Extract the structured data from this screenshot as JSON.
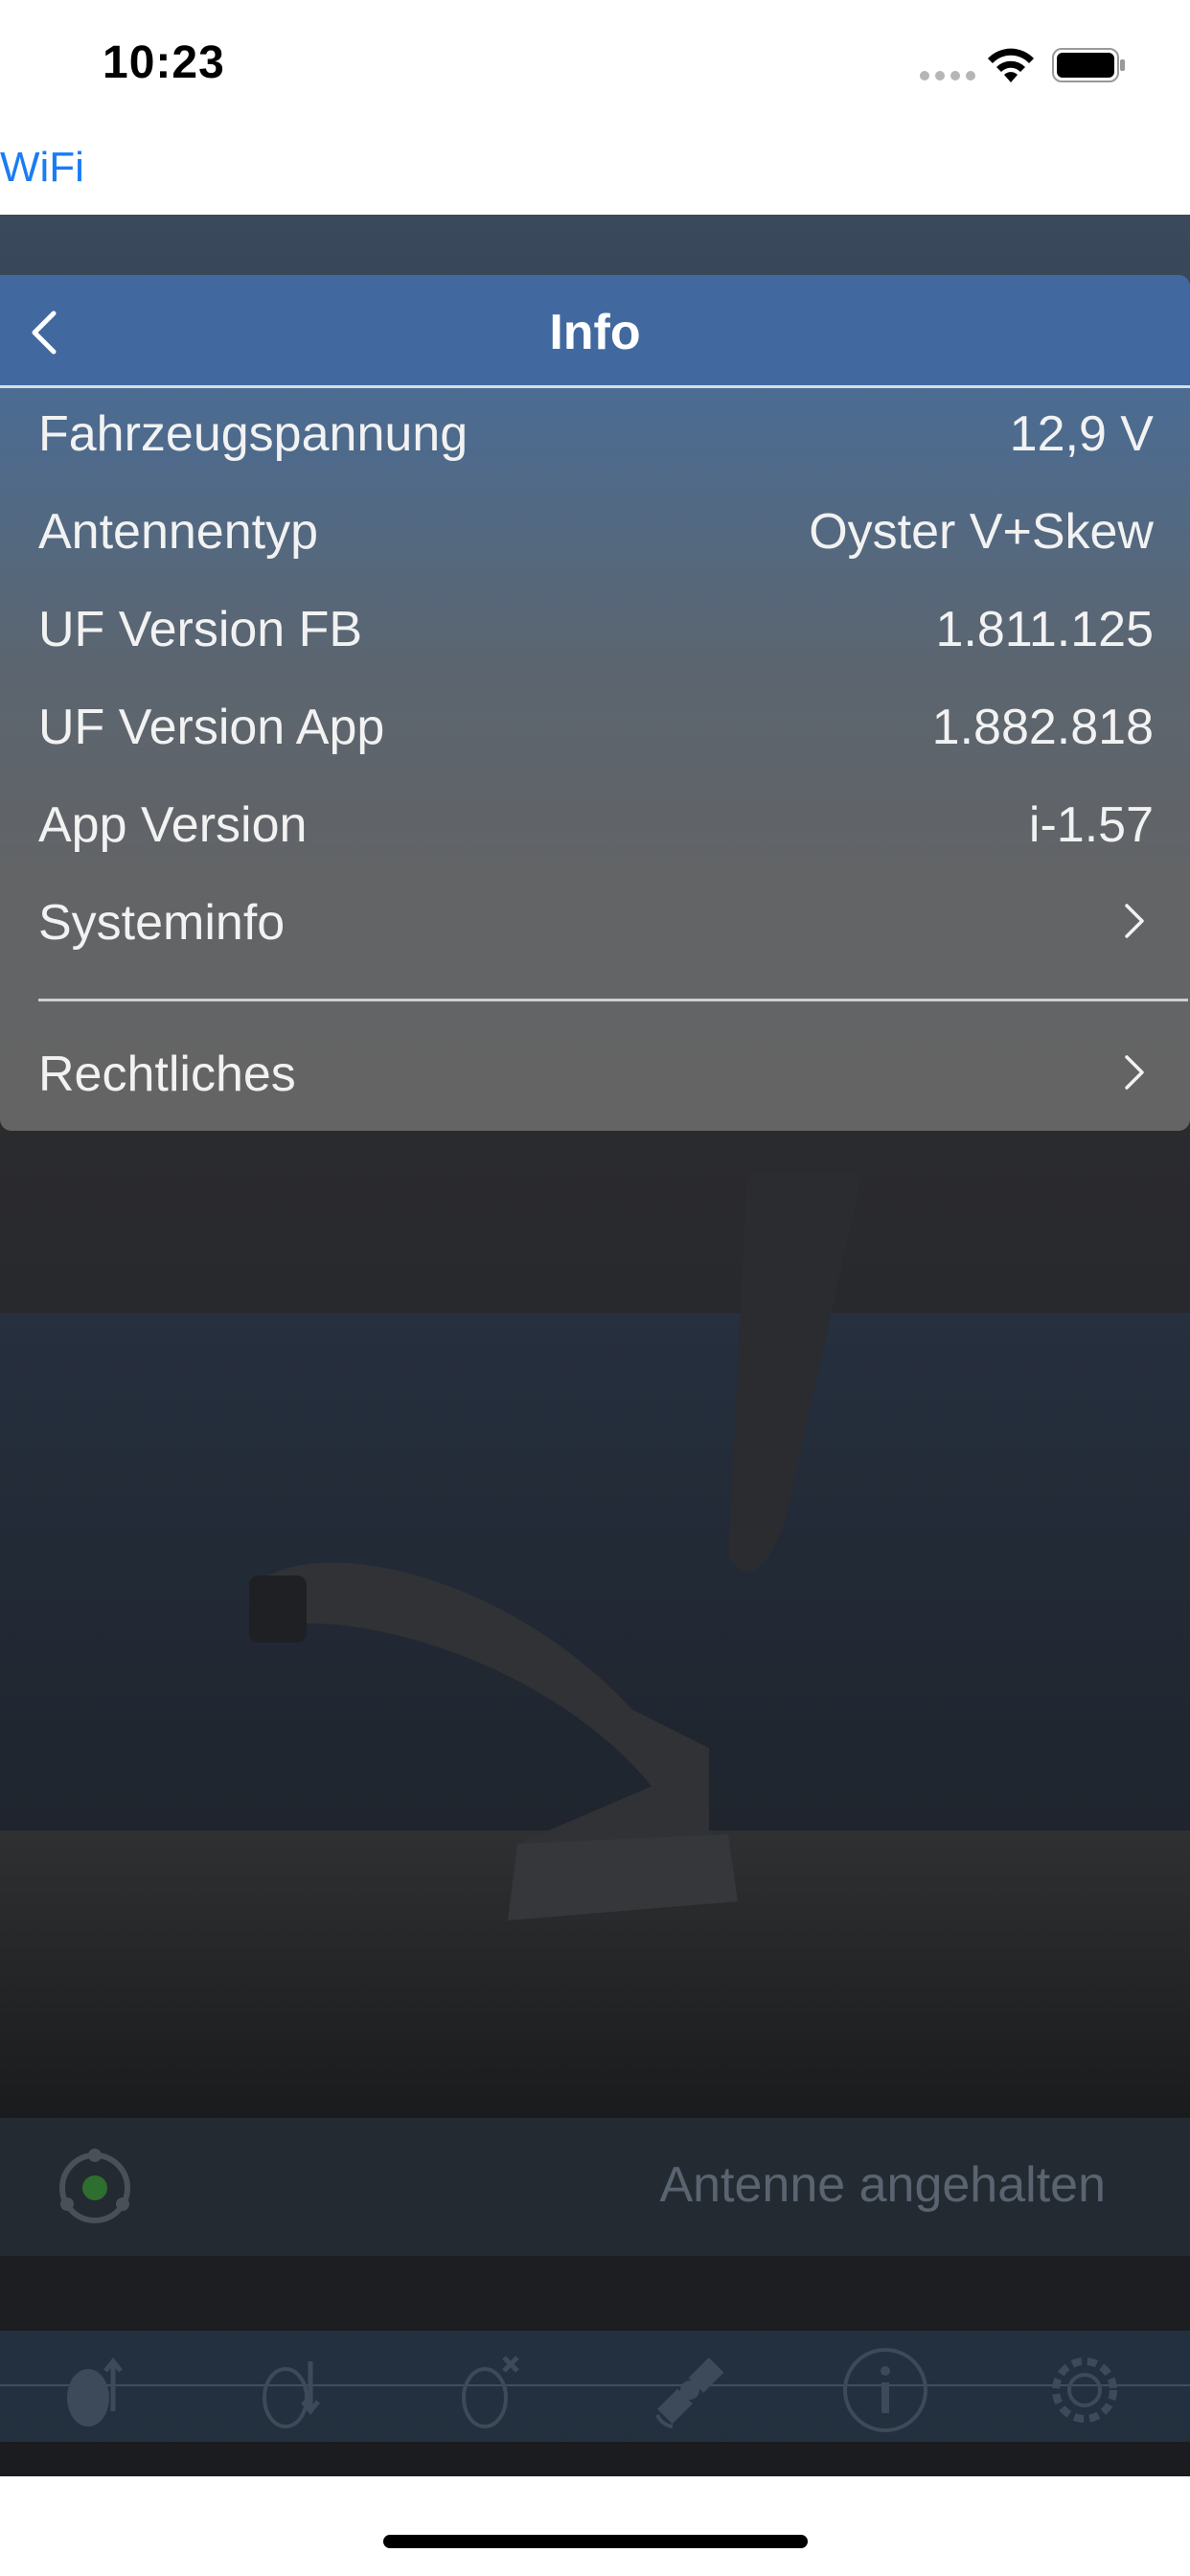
{
  "status_bar": {
    "time": "10:23"
  },
  "nav": {
    "back_label": "WiFi"
  },
  "info": {
    "title": "Info",
    "rows": [
      {
        "label": "Fahrzeugspannung",
        "value": "12,9 V"
      },
      {
        "label": "Antennentyp",
        "value": "Oyster V+Skew"
      },
      {
        "label": "UF Version FB",
        "value": "1.811.125"
      },
      {
        "label": "UF Version App",
        "value": "1.882.818"
      },
      {
        "label": "App Version",
        "value": "i-1.57"
      }
    ],
    "links": [
      {
        "label": "Systeminfo"
      },
      {
        "label": "Rechtliches"
      }
    ]
  },
  "antenna_status": {
    "text": "Antenne angehalten"
  },
  "tabs": [
    {
      "icon": "antenna-up-icon"
    },
    {
      "icon": "antenna-down-icon"
    },
    {
      "icon": "antenna-stop-icon"
    },
    {
      "icon": "satellite-icon"
    },
    {
      "icon": "info-icon"
    },
    {
      "icon": "settings-gear-icon"
    }
  ],
  "colors": {
    "accent": "#1a7cf5",
    "header": "#42699f"
  }
}
